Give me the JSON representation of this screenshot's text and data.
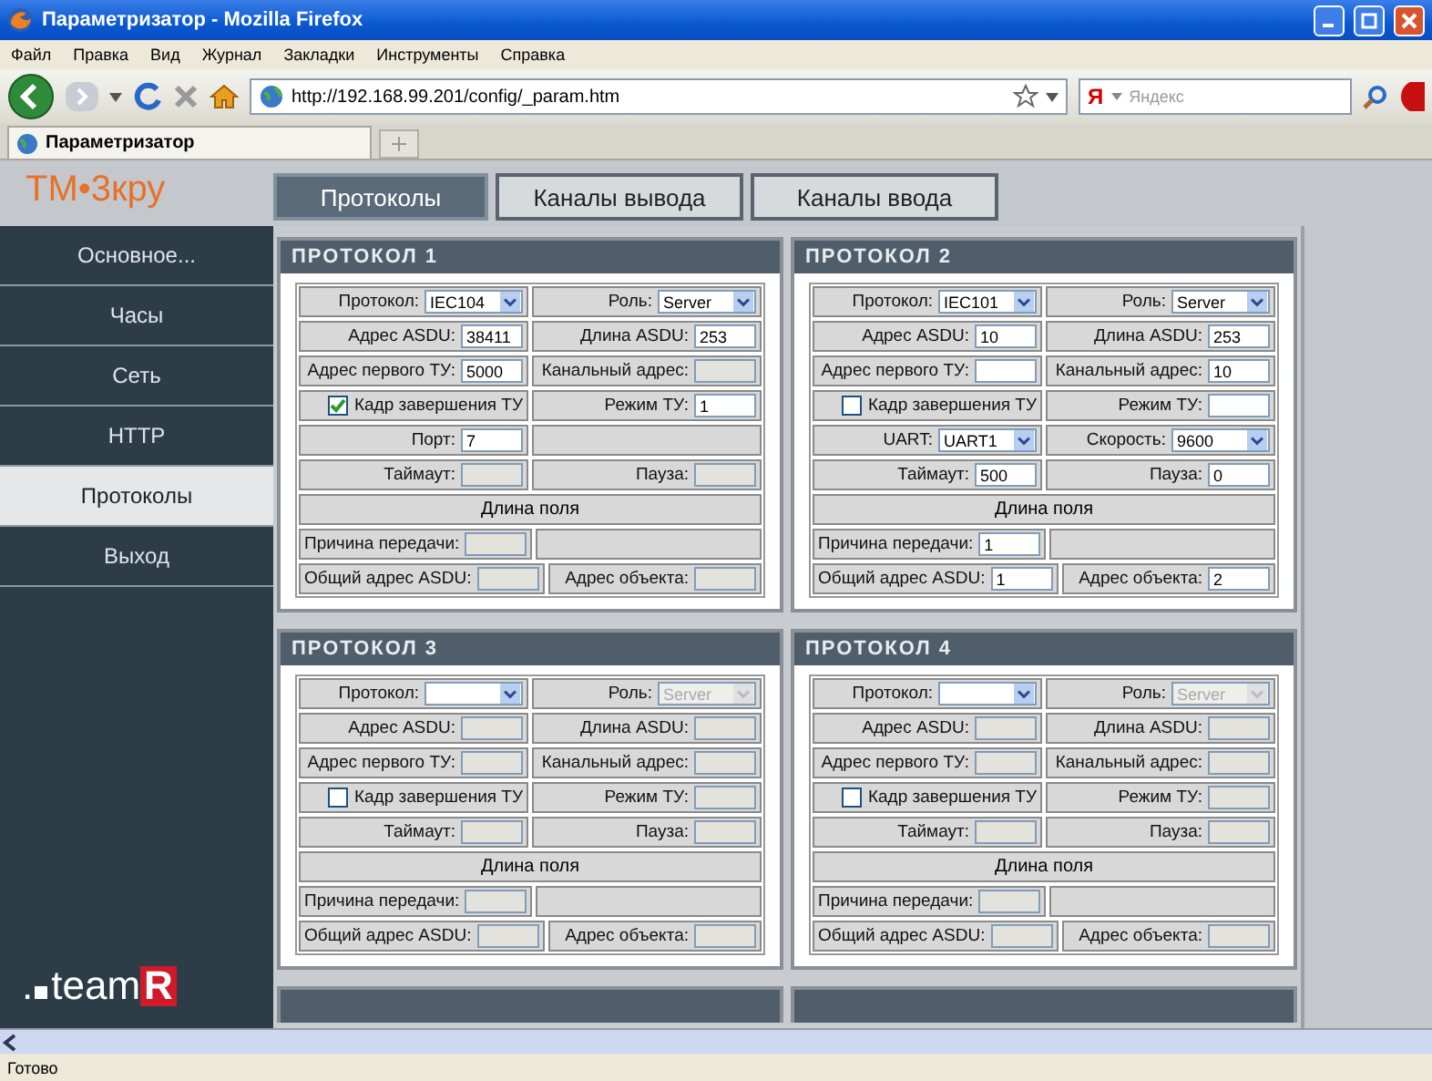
{
  "window": {
    "title": "Параметризатор - Mozilla Firefox"
  },
  "menu": [
    "Файл",
    "Правка",
    "Вид",
    "Журнал",
    "Закладки",
    "Инструменты",
    "Справка"
  ],
  "address": {
    "value": "http://192.168.99.201/config/_param.htm"
  },
  "search": {
    "brand": "Я",
    "placeholder": "Яндекс"
  },
  "browser_tabs": [
    {
      "label": "Параметризатор",
      "selected": true
    }
  ],
  "logo": "ТМ•3кру",
  "tabs": [
    {
      "label": "Протоколы",
      "selected": true
    },
    {
      "label": "Каналы вывода",
      "selected": false
    },
    {
      "label": "Каналы ввода",
      "selected": false
    }
  ],
  "sidebar": {
    "items": [
      {
        "label": "Основное...",
        "selected": false
      },
      {
        "label": "Часы",
        "selected": false
      },
      {
        "label": "Сеть",
        "selected": false
      },
      {
        "label": "HTTP",
        "selected": false
      },
      {
        "label": "Протоколы",
        "selected": true
      },
      {
        "label": "Выход",
        "selected": false
      }
    ],
    "brand": {
      "dot": ".",
      "text": "team",
      "badge": "R"
    }
  },
  "protocols": [
    {
      "title": "ПРОТОКОЛ 1",
      "rows": [
        {
          "kind": "pair",
          "cells": [
            {
              "kind": "select",
              "label": "Протокол:",
              "value": "IEC104",
              "disabled": false
            },
            {
              "kind": "select",
              "label": "Роль:",
              "value": "Server",
              "disabled": false
            }
          ]
        },
        {
          "kind": "pair",
          "cells": [
            {
              "kind": "input",
              "label": "Адрес ASDU:",
              "value": "38411",
              "disabled": false
            },
            {
              "kind": "input",
              "label": "Длина ASDU:",
              "value": "253",
              "disabled": false
            }
          ]
        },
        {
          "kind": "pair",
          "cells": [
            {
              "kind": "input",
              "label": "Адрес первого ТУ:",
              "value": "5000",
              "disabled": false
            },
            {
              "kind": "input",
              "label": "Канальный адрес:",
              "disabled": true
            }
          ]
        },
        {
          "kind": "pair",
          "cells": [
            {
              "kind": "checkbox",
              "label": "Кадр завершения ТУ",
              "checked": true
            },
            {
              "kind": "input",
              "label": "Режим ТУ:",
              "value": "1",
              "disabled": false
            }
          ]
        },
        {
          "kind": "pair",
          "cells": [
            {
              "kind": "input",
              "label": "Порт:",
              "value": "7",
              "disabled": false
            },
            {
              "kind": "blank"
            }
          ]
        },
        {
          "kind": "pair",
          "cells": [
            {
              "kind": "input",
              "label": "Таймаут:",
              "disabled": true
            },
            {
              "kind": "input",
              "label": "Пауза:",
              "disabled": true
            }
          ]
        },
        {
          "kind": "heading",
          "label": "Длина поля"
        },
        {
          "kind": "pair",
          "cells": [
            {
              "kind": "input",
              "label": "Причина передачи:",
              "disabled": true
            },
            {
              "kind": "blank"
            }
          ]
        },
        {
          "kind": "pair",
          "cells": [
            {
              "kind": "input",
              "label": "Общий адрес ASDU:",
              "disabled": true
            },
            {
              "kind": "input",
              "label": "Адрес объекта:",
              "disabled": true
            }
          ]
        }
      ]
    },
    {
      "title": "ПРОТОКОЛ 2",
      "rows": [
        {
          "kind": "pair",
          "cells": [
            {
              "kind": "select",
              "label": "Протокол:",
              "value": "IEC101",
              "disabled": false
            },
            {
              "kind": "select",
              "label": "Роль:",
              "value": "Server",
              "disabled": false
            }
          ]
        },
        {
          "kind": "pair",
          "cells": [
            {
              "kind": "input",
              "label": "Адрес ASDU:",
              "value": "10",
              "disabled": false
            },
            {
              "kind": "input",
              "label": "Длина ASDU:",
              "value": "253",
              "disabled": false
            }
          ]
        },
        {
          "kind": "pair",
          "cells": [
            {
              "kind": "input",
              "label": "Адрес первого ТУ:",
              "disabled": false
            },
            {
              "kind": "input",
              "label": "Канальный адрес:",
              "value": "10",
              "disabled": false
            }
          ]
        },
        {
          "kind": "pair",
          "cells": [
            {
              "kind": "checkbox",
              "label": "Кадр завершения ТУ",
              "checked": false
            },
            {
              "kind": "input",
              "label": "Режим ТУ:",
              "disabled": false
            }
          ]
        },
        {
          "kind": "pair",
          "cells": [
            {
              "kind": "select",
              "label": "UART:",
              "value": "UART1",
              "disabled": false
            },
            {
              "kind": "select",
              "label": "Скорость:",
              "value": "9600",
              "disabled": false
            }
          ]
        },
        {
          "kind": "pair",
          "cells": [
            {
              "kind": "input",
              "label": "Таймаут:",
              "value": "500",
              "disabled": false
            },
            {
              "kind": "input",
              "label": "Пауза:",
              "value": "0",
              "disabled": false
            }
          ]
        },
        {
          "kind": "heading",
          "label": "Длина поля"
        },
        {
          "kind": "pair",
          "cells": [
            {
              "kind": "input",
              "label": "Причина передачи:",
              "value": "1",
              "disabled": false
            },
            {
              "kind": "blank"
            }
          ]
        },
        {
          "kind": "pair",
          "cells": [
            {
              "kind": "input",
              "label": "Общий адрес ASDU:",
              "value": "1",
              "disabled": false
            },
            {
              "kind": "input",
              "label": "Адрес объекта:",
              "value": "2",
              "disabled": false
            }
          ]
        }
      ]
    },
    {
      "title": "ПРОТОКОЛ 3",
      "rows": [
        {
          "kind": "pair",
          "cells": [
            {
              "kind": "select",
              "label": "Протокол:",
              "disabled": false
            },
            {
              "kind": "select",
              "label": "Роль:",
              "value": "Server",
              "disabled": true
            }
          ]
        },
        {
          "kind": "pair",
          "cells": [
            {
              "kind": "input",
              "label": "Адрес ASDU:",
              "disabled": true
            },
            {
              "kind": "input",
              "label": "Длина ASDU:",
              "disabled": true
            }
          ]
        },
        {
          "kind": "pair",
          "cells": [
            {
              "kind": "input",
              "label": "Адрес первого ТУ:",
              "disabled": true
            },
            {
              "kind": "input",
              "label": "Канальный адрес:",
              "disabled": true
            }
          ]
        },
        {
          "kind": "pair",
          "cells": [
            {
              "kind": "checkbox",
              "label": "Кадр завершения ТУ",
              "checked": false
            },
            {
              "kind": "input",
              "label": "Режим ТУ:",
              "disabled": true
            }
          ]
        },
        {
          "kind": "pair",
          "cells": [
            {
              "kind": "input",
              "label": "Таймаут:",
              "disabled": true
            },
            {
              "kind": "input",
              "label": "Пауза:",
              "disabled": true
            }
          ]
        },
        {
          "kind": "heading",
          "label": "Длина поля"
        },
        {
          "kind": "pair",
          "cells": [
            {
              "kind": "input",
              "label": "Причина передачи:",
              "disabled": true
            },
            {
              "kind": "blank"
            }
          ]
        },
        {
          "kind": "pair",
          "cells": [
            {
              "kind": "input",
              "label": "Общий адрес ASDU:",
              "disabled": true
            },
            {
              "kind": "input",
              "label": "Адрес объекта:",
              "disabled": true
            }
          ]
        }
      ]
    },
    {
      "title": "ПРОТОКОЛ 4",
      "rows": [
        {
          "kind": "pair",
          "cells": [
            {
              "kind": "select",
              "label": "Протокол:",
              "disabled": false
            },
            {
              "kind": "select",
              "label": "Роль:",
              "value": "Server",
              "disabled": true
            }
          ]
        },
        {
          "kind": "pair",
          "cells": [
            {
              "kind": "input",
              "label": "Адрес ASDU:",
              "disabled": true
            },
            {
              "kind": "input",
              "label": "Длина ASDU:",
              "disabled": true
            }
          ]
        },
        {
          "kind": "pair",
          "cells": [
            {
              "kind": "input",
              "label": "Адрес первого ТУ:",
              "disabled": true
            },
            {
              "kind": "input",
              "label": "Канальный адрес:",
              "disabled": true
            }
          ]
        },
        {
          "kind": "pair",
          "cells": [
            {
              "kind": "checkbox",
              "label": "Кадр завершения ТУ",
              "checked": false
            },
            {
              "kind": "input",
              "label": "Режим ТУ:",
              "disabled": true
            }
          ]
        },
        {
          "kind": "pair",
          "cells": [
            {
              "kind": "input",
              "label": "Таймаут:",
              "disabled": true
            },
            {
              "kind": "input",
              "label": "Пауза:",
              "disabled": true
            }
          ]
        },
        {
          "kind": "heading",
          "label": "Длина поля"
        },
        {
          "kind": "pair",
          "cells": [
            {
              "kind": "input",
              "label": "Причина передачи:",
              "disabled": true
            },
            {
              "kind": "blank"
            }
          ]
        },
        {
          "kind": "pair",
          "cells": [
            {
              "kind": "input",
              "label": "Общий адрес ASDU:",
              "disabled": true
            },
            {
              "kind": "input",
              "label": "Адрес объекта:",
              "disabled": true
            }
          ]
        }
      ]
    }
  ],
  "status_bar": "Готово"
}
